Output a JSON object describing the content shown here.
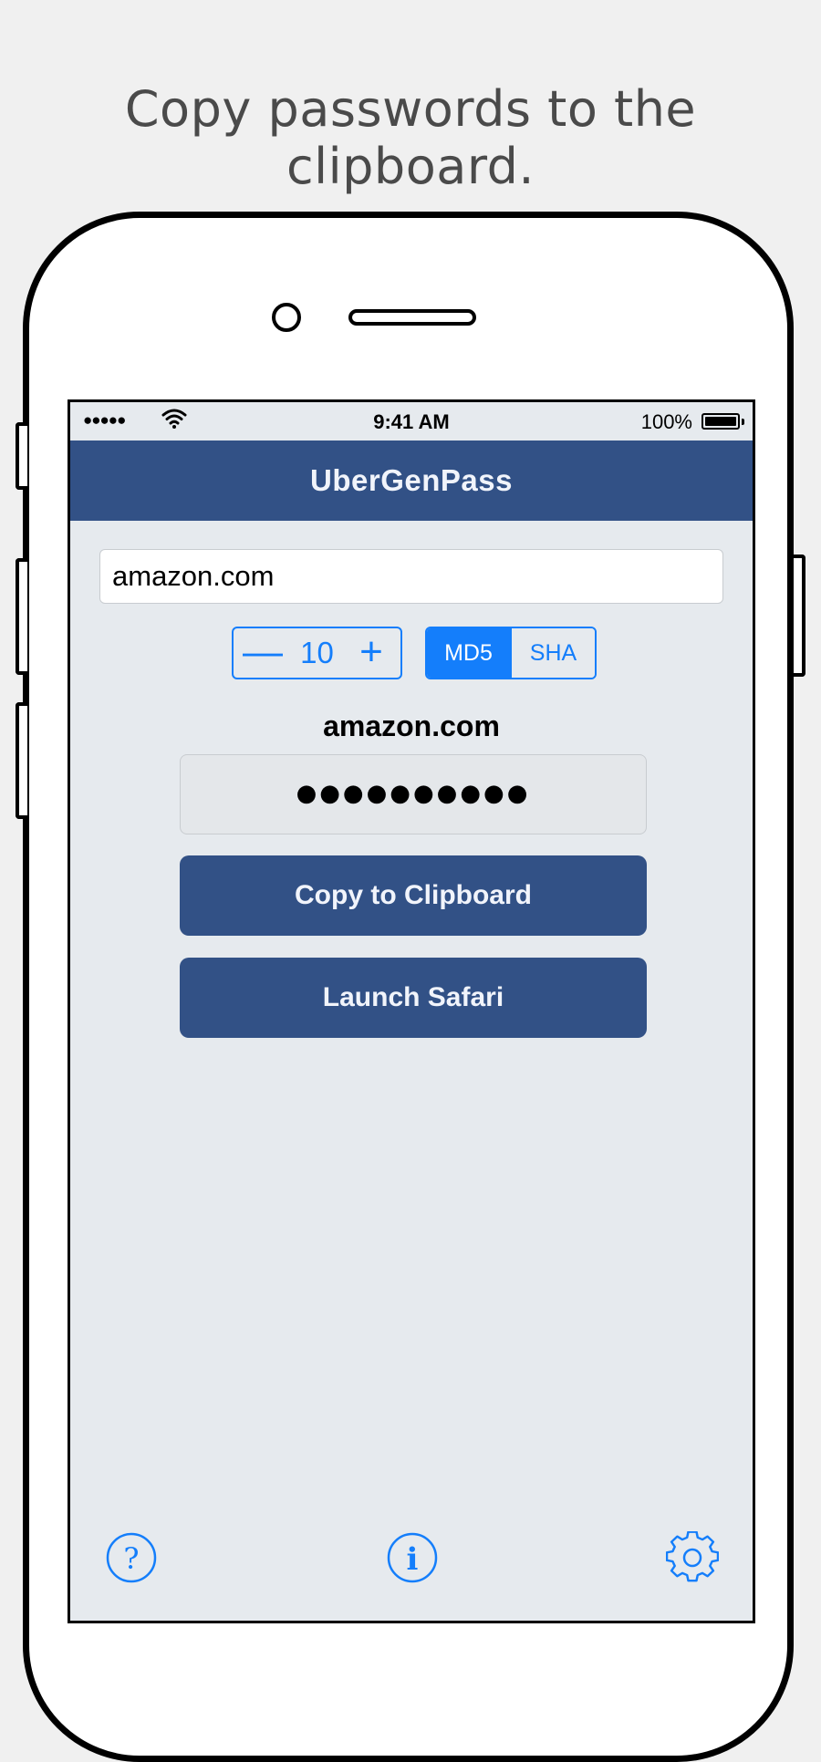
{
  "headline": "Copy passwords to the clipboard.",
  "status_bar": {
    "signal": "●●●●●",
    "time": "9:41 AM",
    "battery": "100%"
  },
  "app": {
    "title": "UberGenPass",
    "domain_input_value": "amazon.com",
    "length_stepper": {
      "minus": "—",
      "value": "10",
      "plus": "+"
    },
    "hash_algorithm": {
      "options": [
        "MD5",
        "SHA"
      ],
      "selected": "MD5"
    },
    "result_domain": "amazon.com",
    "password_mask": "●●●●●●●●●●",
    "copy_button": "Copy to Clipboard",
    "launch_button": "Launch Safari",
    "toolbar": {
      "help_icon": "question-circle-icon",
      "info_icon": "info-circle-icon",
      "settings_icon": "gear-icon"
    }
  },
  "colors": {
    "background": "#f0f0f0",
    "nav_bar": "#325186",
    "accent": "#147efb",
    "screen_bg": "#e6eaee"
  }
}
